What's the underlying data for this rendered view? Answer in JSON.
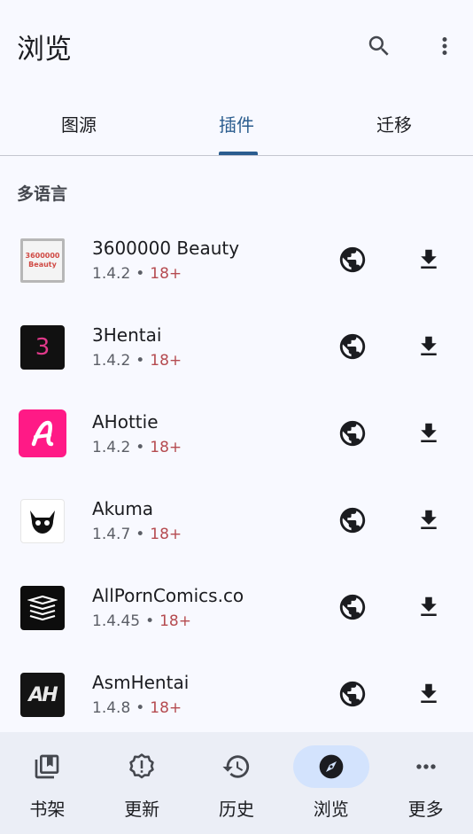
{
  "appbar": {
    "title": "浏览",
    "search_icon": "search-icon",
    "more_icon": "more-vert-icon"
  },
  "tabs": [
    {
      "label": "图源",
      "active": false
    },
    {
      "label": "插件",
      "active": true
    },
    {
      "label": "迁移",
      "active": false
    }
  ],
  "section": {
    "header": "多语言"
  },
  "extensions": [
    {
      "name": "3600000 Beauty",
      "version": "1.4.2",
      "age": "18+",
      "logo_text_1": "3600000",
      "logo_text_2": "Beauty"
    },
    {
      "name": "3Hentai",
      "version": "1.4.2",
      "age": "18+",
      "logo_text_1": "3"
    },
    {
      "name": "AHottie",
      "version": "1.4.2",
      "age": "18+"
    },
    {
      "name": "Akuma",
      "version": "1.4.7",
      "age": "18+"
    },
    {
      "name": "AllPornComics.co",
      "version": "1.4.45",
      "age": "18+"
    },
    {
      "name": "AsmHentai",
      "version": "1.4.8",
      "age": "18+",
      "logo_text_1": "AH"
    }
  ],
  "bottom_nav": [
    {
      "label": "书架",
      "icon": "library-icon",
      "active": false
    },
    {
      "label": "更新",
      "icon": "updates-alert-icon",
      "active": false
    },
    {
      "label": "历史",
      "icon": "history-icon",
      "active": false
    },
    {
      "label": "浏览",
      "icon": "explore-compass-icon",
      "active": true
    },
    {
      "label": "更多",
      "icon": "more-horiz-icon",
      "active": false
    }
  ],
  "colors": {
    "accent": "#2b5d8f",
    "age_badge": "#b54b50",
    "background": "#f8f9ff",
    "nav_background": "#ebeef6",
    "nav_active_pill": "#d3e3fd"
  },
  "dot": "•"
}
